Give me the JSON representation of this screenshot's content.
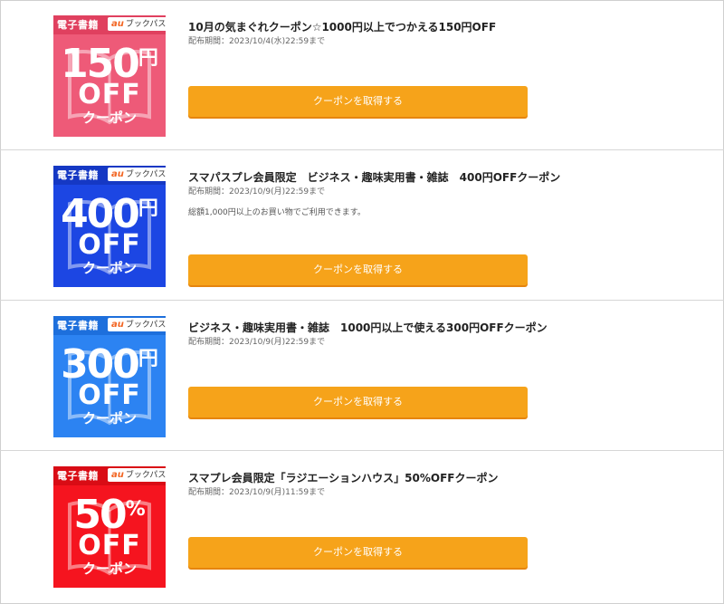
{
  "coupons": [
    {
      "banner": {
        "category": "電子書籍",
        "brand_au": "au",
        "brand_name": "ブックパス",
        "amount": "150",
        "unit": "円",
        "off": "OFF",
        "coupon_word": "クーポン",
        "color": "#ee5a78",
        "bar_color": "#e0405f"
      },
      "title": "10月の気まぐれクーポン☆1000円以上でつかえる150円OFF",
      "period": "配布期間：2023/10/4(水)22:59まで",
      "note": "",
      "button_label": "クーポンを取得する"
    },
    {
      "banner": {
        "category": "電子書籍",
        "brand_au": "au",
        "brand_name": "ブックパス",
        "amount": "400",
        "unit": "円",
        "off": "OFF",
        "coupon_word": "クーポン",
        "color": "#1c46e3",
        "bar_color": "#1538c4"
      },
      "title": "スマパスプレ会員限定　ビジネス・趣味実用書・雑誌　400円OFFクーポン",
      "period": "配布期間：2023/10/9(月)22:59まで",
      "note": "総額1,000円以上のお買い物でご利用できます。",
      "button_label": "クーポンを取得する"
    },
    {
      "banner": {
        "category": "電子書籍",
        "brand_au": "au",
        "brand_name": "ブックパス",
        "amount": "300",
        "unit": "円",
        "off": "OFF",
        "coupon_word": "クーポン",
        "color": "#2c83f2",
        "bar_color": "#1d6fdc"
      },
      "title": "ビジネス・趣味実用書・雑誌　1000円以上で使える300円OFFクーポン",
      "period": "配布期間：2023/10/9(月)22:59まで",
      "note": "",
      "button_label": "クーポンを取得する"
    },
    {
      "banner": {
        "category": "電子書籍",
        "brand_au": "au",
        "brand_name": "ブックパス",
        "amount": "50",
        "unit": "%",
        "off": "OFF",
        "coupon_word": "クーポン",
        "color": "#f5141f",
        "bar_color": "#d90c15"
      },
      "title": "スマプレ会員限定「ラジエーションハウス」50%OFFクーポン",
      "period": "配布期間：2023/10/9(月)11:59まで",
      "note": "",
      "button_label": "クーポンを取得する"
    }
  ]
}
